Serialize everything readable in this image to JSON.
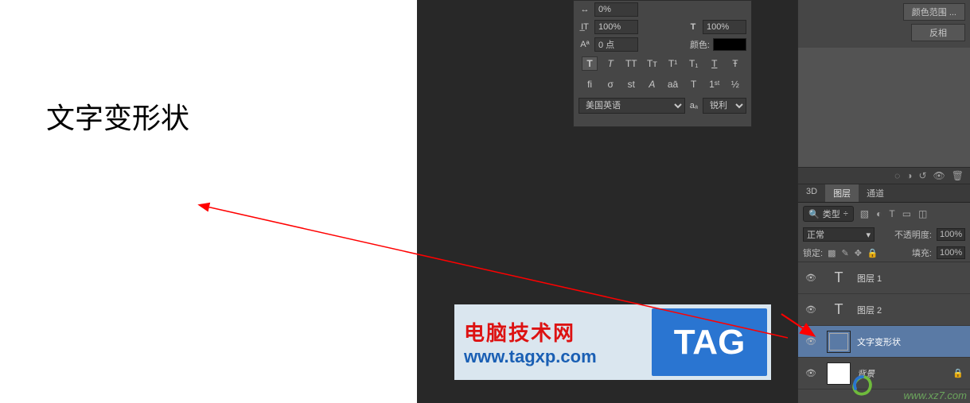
{
  "canvas_text": "文字变形状",
  "watermark": {
    "line1": "电脑技术网",
    "line2": "www.tagxp.com",
    "tag": "TAG"
  },
  "char_panel": {
    "tracking_icon": "0%",
    "height_pct": "100%",
    "width_pct": "100%",
    "baseline": "0 点",
    "color_label": "颜色:",
    "style_T": "T",
    "lang": "美国英语",
    "aa_icon": "aₐ",
    "aa_mode": "锐利"
  },
  "right": {
    "btn1": "颜色范围 ...",
    "btn2": "反相",
    "tabs": {
      "t3d": "3D",
      "layers": "图层",
      "channels": "通道"
    },
    "filter_label": "类型",
    "blend": {
      "mode": "正常",
      "opacity_label": "不透明度:",
      "opacity": "100%"
    },
    "lock": {
      "label": "锁定:",
      "fill_label": "填充:",
      "fill": "100%"
    },
    "layers": {
      "l1": "图层 1",
      "l2": "图层 2",
      "l3": "文字变形状",
      "l4": "背景"
    }
  },
  "credit": "www.xz7.com"
}
